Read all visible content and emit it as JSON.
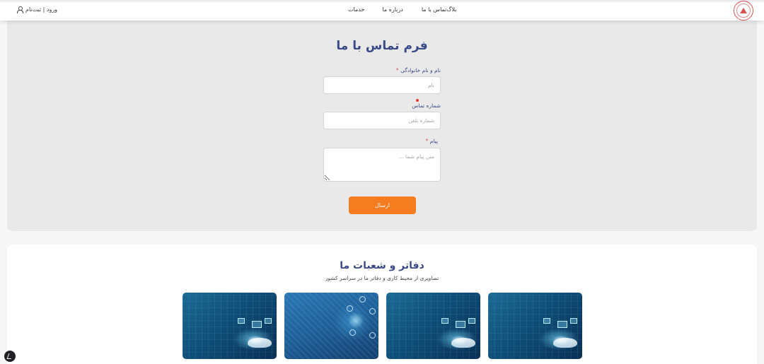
{
  "header": {
    "nav": [
      "خدمات",
      "درباره ما",
      "تماس با ما",
      "بلاگ"
    ],
    "login_label": "ورود | ثبت‌نام"
  },
  "contact_form": {
    "title": "فرم تماس با ما",
    "name_label": "نام و نام خانوادگی",
    "name_placeholder": "نام",
    "phone_label": "شماره تماس",
    "phone_placeholder": "شماره تلفن",
    "message_label": "پیام",
    "message_placeholder": "متن پیام شما ...",
    "required_mark": "*",
    "submit_label": "ارسال"
  },
  "offices": {
    "title": "دفاتر و شعبات ما",
    "subtitle": "تصاویری از محیط کاری و دفاتر ما در سراسر کشور"
  },
  "colors": {
    "primary": "#3a4a86",
    "accent": "#f57c1f",
    "required": "#d9534f"
  }
}
